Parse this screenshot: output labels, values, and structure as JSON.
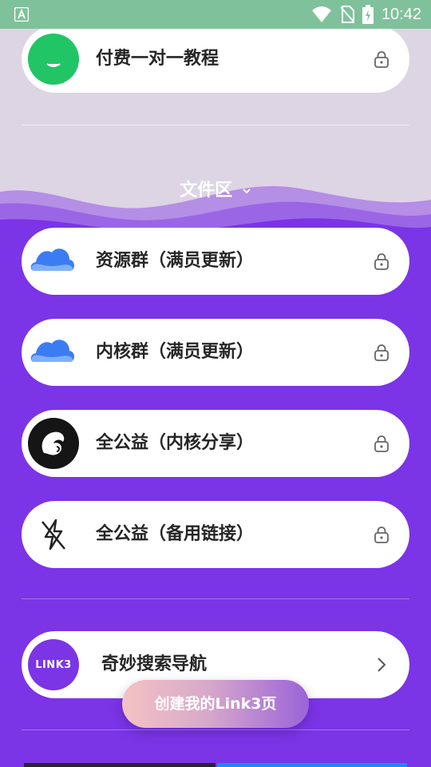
{
  "status_bar": {
    "time": "10:42",
    "icons": [
      "notification-a-icon",
      "wifi-icon",
      "no-sim-icon",
      "battery-charging-icon"
    ]
  },
  "cards": {
    "paid_tutorial": {
      "label": "付费一对一教程",
      "icon": "green-smile-icon",
      "trailing": "lock-icon"
    },
    "resource_group": {
      "label": "资源群（满员更新）",
      "icon": "blue-cloud-icon",
      "trailing": "lock-icon"
    },
    "core_group": {
      "label": "内核群（满员更新）",
      "icon": "blue-cloud-icon",
      "trailing": "lock-icon"
    },
    "public_share": {
      "label": "全公益（内核分享）",
      "icon": "squirrel-logo-icon",
      "trailing": "lock-icon"
    },
    "public_backup": {
      "label": "全公益（备用链接）",
      "icon": "lightning-off-icon",
      "trailing": "lock-icon"
    },
    "search_nav": {
      "label": "奇妙搜索导航",
      "icon": "link3-logo-icon",
      "icon_text": "LINK3",
      "trailing": "chevron-right-icon"
    }
  },
  "section": {
    "title": "文件区"
  },
  "create_button": {
    "label": "创建我的Link3页"
  },
  "colors": {
    "status_bar": "#7fc19b",
    "top_background": "#ddd4e4",
    "main_background": "#7b34e6",
    "card": "#ffffff",
    "link3_purple": "#7b34e6"
  }
}
